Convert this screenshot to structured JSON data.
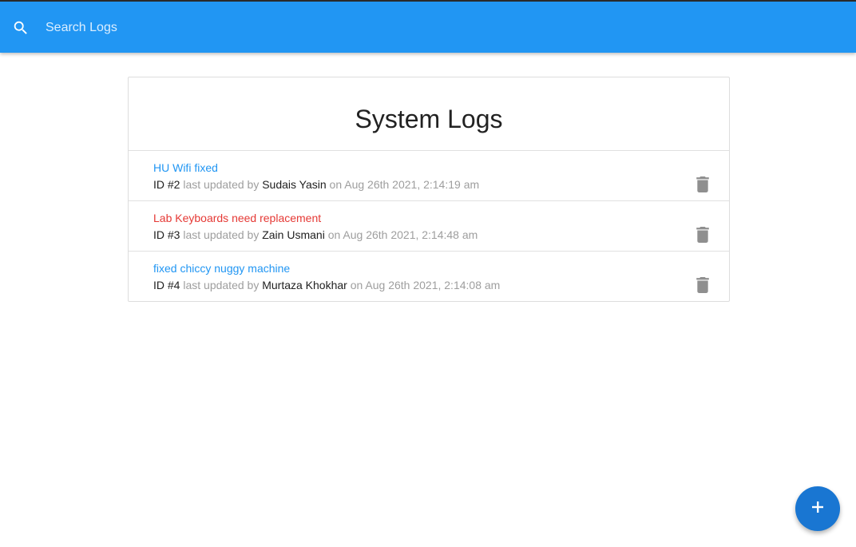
{
  "search": {
    "placeholder": "Search Logs",
    "icon": "search-icon"
  },
  "page": {
    "title": "System Logs"
  },
  "colors": {
    "topbar": "#2196f3",
    "fab": "#1976d2",
    "normal_message": "#2196f3",
    "attention_message": "#e53935"
  },
  "logs": [
    {
      "message": "HU Wifi fixed",
      "attention": false,
      "id_label": "ID #2",
      "updated_by_text": "last updated by",
      "tech": "Sudais Yasin",
      "date": "on Aug 26th 2021, 2:14:19 am"
    },
    {
      "message": "Lab Keyboards need replacement",
      "attention": true,
      "id_label": "ID #3",
      "updated_by_text": "last updated by",
      "tech": "Zain Usmani",
      "date": "on Aug 26th 2021, 2:14:48 am"
    },
    {
      "message": "fixed chiccy nuggy machine",
      "attention": false,
      "id_label": "ID #4",
      "updated_by_text": "last updated by",
      "tech": "Murtaza Khokhar",
      "date": "on Aug 26th 2021, 2:14:08 am"
    }
  ],
  "fab": {
    "icon": "plus-icon"
  }
}
